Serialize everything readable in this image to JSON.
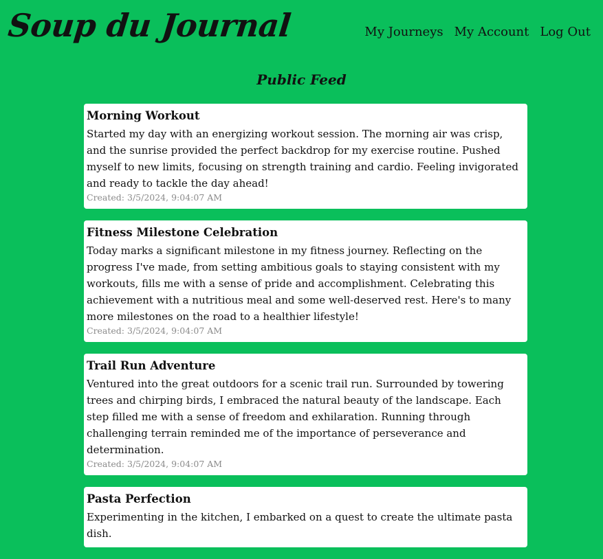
{
  "header": {
    "brand": "Soup du Journal",
    "nav": [
      "My Journeys",
      "My Account",
      "Log Out"
    ]
  },
  "feed": {
    "title": "Public Feed",
    "posts": [
      {
        "title": "Morning Workout",
        "body": "Started my day with an energizing workout session. The morning air was crisp, and the sunrise provided the perfect backdrop for my exercise routine. Pushed myself to new limits, focusing on strength training and cardio. Feeling invigorated and ready to tackle the day ahead!",
        "created": "Created: 3/5/2024, 9:04:07 AM"
      },
      {
        "title": "Fitness Milestone Celebration",
        "body": "Today marks a significant milestone in my fitness journey. Reflecting on the progress I've made, from setting ambitious goals to staying consistent with my workouts, fills me with a sense of pride and accomplishment. Celebrating this achievement with a nutritious meal and some well-deserved rest. Here's to many more milestones on the road to a healthier lifestyle!",
        "created": "Created: 3/5/2024, 9:04:07 AM"
      },
      {
        "title": "Trail Run Adventure",
        "body": "Ventured into the great outdoors for a scenic trail run. Surrounded by towering trees and chirping birds, I embraced the natural beauty of the landscape. Each step filled me with a sense of freedom and exhilaration. Running through challenging terrain reminded me of the importance of perseverance and determination.",
        "created": "Created: 3/5/2024, 9:04:07 AM"
      },
      {
        "title": "Pasta Perfection",
        "body": "Experimenting in the kitchen, I embarked on a quest to create the ultimate pasta dish.",
        "created": ""
      }
    ]
  },
  "colors": {
    "background": "#0abf5b",
    "card": "#ffffff",
    "meta_text": "#8a8a8a"
  }
}
